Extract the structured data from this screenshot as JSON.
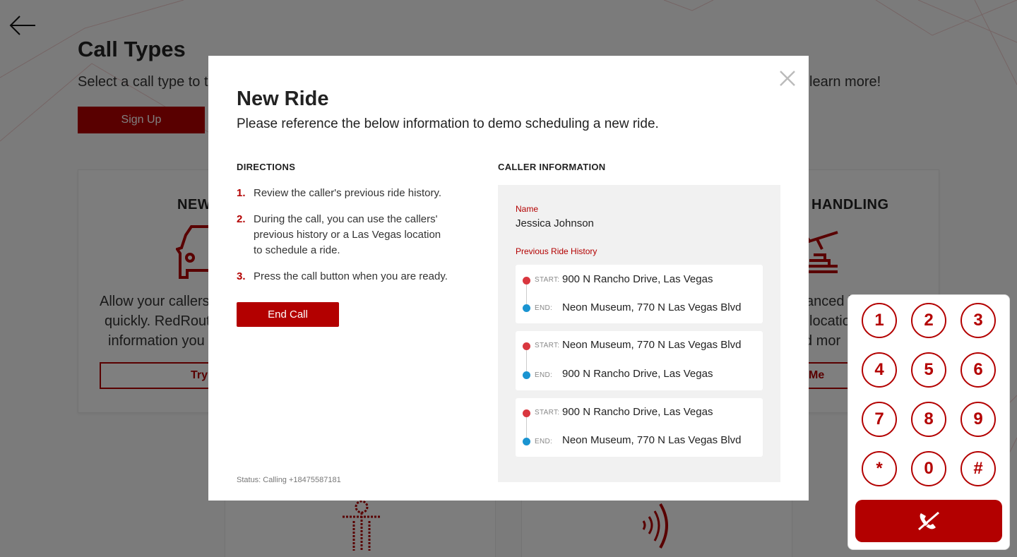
{
  "background": {
    "title": "Call Types",
    "subtitle_left": "Select a call type to t",
    "subtitle_right": "learn more!",
    "signup_label": "Sign Up",
    "card_left": {
      "title": "NEW",
      "text_lines": [
        "Allow your callers",
        "quickly. RedRout",
        "information you"
      ],
      "button_label": "Try"
    },
    "card_right": {
      "title": "HANDLING",
      "text_lines": [
        "anced l",
        "locatio",
        "d mor"
      ],
      "button_label": "Me"
    }
  },
  "modal": {
    "title": "New Ride",
    "subtitle": "Please reference the below information to demo scheduling a new ride.",
    "directions_label": "DIRECTIONS",
    "steps": [
      {
        "num": "1.",
        "text": "Review the caller's previous ride history."
      },
      {
        "num": "2.",
        "text": "During the call, you can use the callers' previous history or a Las Vegas location to schedule a ride."
      },
      {
        "num": "3.",
        "text": "Press the call button when you are ready."
      }
    ],
    "end_call_label": "End Call",
    "status": "Status: Calling +18475587181",
    "caller_label": "CALLER INFORMATION",
    "name_label": "Name",
    "name_value": "Jessica Johnson",
    "history_label": "Previous Ride History",
    "start_tag": "START:",
    "end_tag": "END:",
    "rides": [
      {
        "start": "900 N Rancho Drive, Las Vegas",
        "end": "Neon Museum, 770 N Las Vegas Blvd"
      },
      {
        "start": "Neon Museum, 770 N Las Vegas Blvd",
        "end": "900 N Rancho Drive, Las Vegas"
      },
      {
        "start": "900 N Rancho Drive, Las Vegas",
        "end": "Neon Museum, 770 N Las Vegas Blvd"
      }
    ]
  },
  "dialer": {
    "keys": [
      "1",
      "2",
      "3",
      "4",
      "5",
      "6",
      "7",
      "8",
      "9",
      "*",
      "0",
      "#"
    ],
    "hangup_icon": "phone-hangup-icon"
  },
  "colors": {
    "brand_red": "#b30000",
    "start_dot": "#d9373f",
    "end_dot": "#1a94d1"
  }
}
